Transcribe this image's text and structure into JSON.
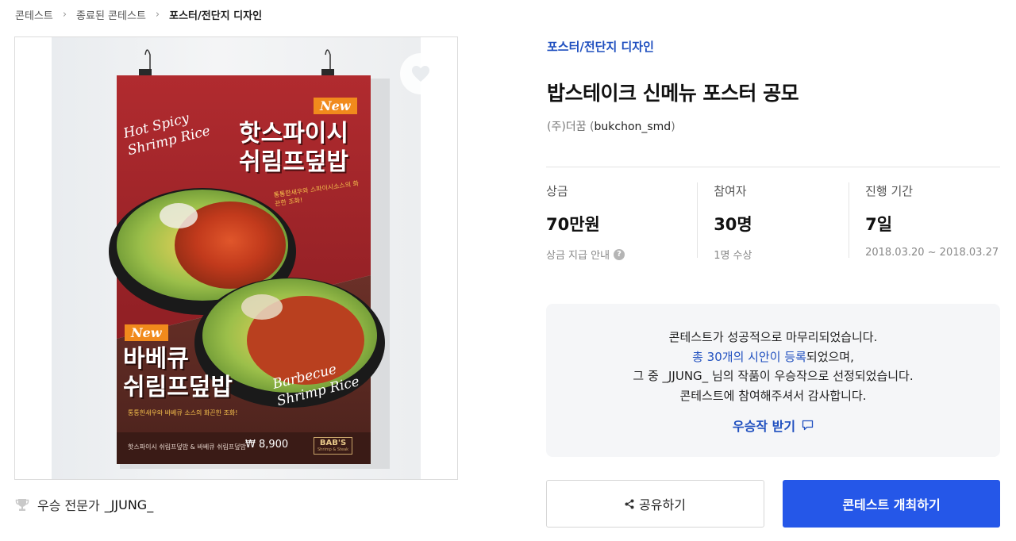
{
  "breadcrumb": {
    "items": [
      "콘테스트",
      "종료된 콘테스트",
      "포스터/전단지 디자인"
    ]
  },
  "poster": {
    "tag_top": "New",
    "title_top": "핫스파이시\n쉬림프덮밥",
    "script_top": "Hot Spicy\nShrimp Rice",
    "desc_top": "통통한새우와 스파이시소스의 화끈한 조화!",
    "tag_bottom": "New",
    "title_bottom": "바베큐\n쉬림프덮밥",
    "script_bottom": "Barbecue\nShrimp Rice",
    "desc_bottom": "통통한새우와 바베큐 소스의 화끈한 조화!",
    "footer_text": "핫스파이시 쉬림프덮밥 & 바베큐 쉬림프덮밥",
    "price": "₩ 8,900",
    "brand": "BAB'S",
    "brand_sub": "Shrimp & Steak",
    "colors": {
      "top_bg": "#a8282c",
      "bottom_bg": "#5c2a22",
      "tag_orange": "#f18a1c"
    }
  },
  "winner": {
    "label": "우승 전문가",
    "name": "_JJUNG_"
  },
  "contest": {
    "category": "포스터/전단지 디자인",
    "title": "밥스테이크 신메뉴 포스터 공모",
    "host_name": "(주)더꿈",
    "host_handle": "bukchon_smd"
  },
  "stats": [
    {
      "label": "상금",
      "value": "70만원",
      "sub": "상금 지급 안내"
    },
    {
      "label": "참여자",
      "value": "30명",
      "sub": "1명 수상"
    },
    {
      "label": "진행 기간",
      "value": "7일",
      "sub": "2018.03.20 ~ 2018.03.27"
    }
  ],
  "notice": {
    "line1": "콘테스트가 성공적으로 마무리되었습니다.",
    "line2_highlight": "총 30개의 시안이 등록",
    "line2_rest": "되었으며,",
    "line3": "그 중 _JJUNG_ 님의 작품이 우승작으로 선정되었습니다.",
    "line4": "콘테스트에 참여해주셔서 감사합니다.",
    "receive": "우승작 받기"
  },
  "actions": {
    "share": "공유하기",
    "host_contest": "콘테스트 개최하기"
  },
  "theme": {
    "accent": "#2557e8",
    "link": "#1f4fbf"
  }
}
